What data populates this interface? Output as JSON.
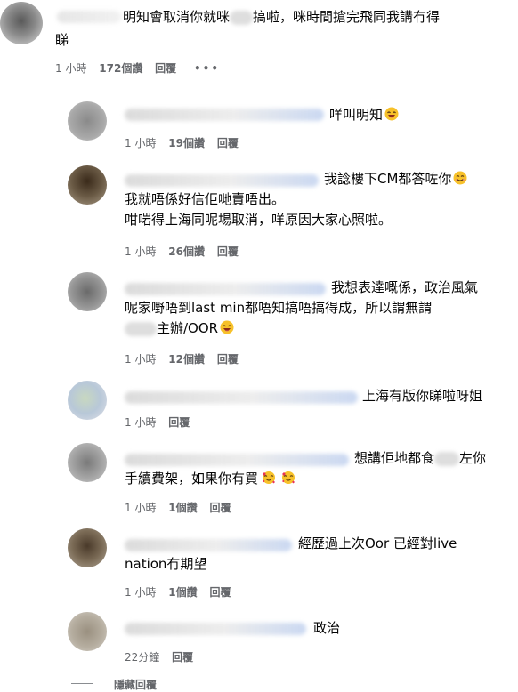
{
  "comments": [
    {
      "line1": "明知會取消你就咪",
      "line1b": "搞啦，咪時間搶完飛同我講冇得",
      "line2": "睇",
      "meta": {
        "time": "1 小時",
        "likes": "172個讚",
        "reply": "回覆",
        "more": "•••"
      }
    },
    {
      "text": "咩叫明知",
      "meta": {
        "time": "1 小時",
        "likes": "19個讚",
        "reply": "回覆"
      }
    },
    {
      "line1": "我諗樓下CM都答咗你",
      "line2": "我就唔係好信佢哋賣唔出。",
      "line3": "咁啱得上海同呢場取消，咩原因大家心照啦。",
      "meta": {
        "time": "1 小時",
        "likes": "26個讚",
        "reply": "回覆"
      }
    },
    {
      "line1": "我想表達嘅係，政治風氣",
      "line2": "呢家嘢唔到last min都唔知搞唔搞得成，所以謂無謂",
      "line3": "主辦/OOR",
      "meta": {
        "time": "1 小時",
        "likes": "12個讚",
        "reply": "回覆"
      }
    },
    {
      "text": "上海有版你睇啦呀姐",
      "meta": {
        "time": "1 小時",
        "reply": "回覆"
      }
    },
    {
      "line1a": "想講佢地都食",
      "line1b": "左你",
      "line2": "手續費架，如果你有買",
      "meta": {
        "time": "1 小時",
        "likes": "1個讚",
        "reply": "回覆"
      }
    },
    {
      "line1": "經歷過上次Oor 已經對live",
      "line2": "nation冇期望",
      "meta": {
        "time": "1 小時",
        "likes": "1個讚",
        "reply": "回覆"
      }
    },
    {
      "text": "政治",
      "meta": {
        "time": "22分鐘",
        "reply": "回覆"
      }
    }
  ],
  "footer": {
    "hide_replies": "隱藏回覆"
  },
  "colors": {
    "text": "#050505",
    "meta": "#65676b"
  }
}
